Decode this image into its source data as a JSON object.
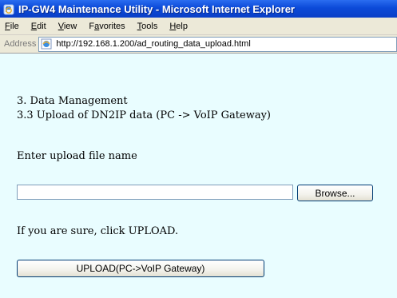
{
  "window": {
    "title": "IP-GW4 Maintenance Utility - Microsoft Internet Explorer",
    "icon": "ie-icon"
  },
  "menu": {
    "items": [
      {
        "label": "File",
        "key": "F"
      },
      {
        "label": "Edit",
        "key": "E"
      },
      {
        "label": "View",
        "key": "V"
      },
      {
        "label": "Favorites",
        "key": "a"
      },
      {
        "label": "Tools",
        "key": "T"
      },
      {
        "label": "Help",
        "key": "H"
      }
    ]
  },
  "address_bar": {
    "label": "Address",
    "url": "http://192.168.1.200/ad_routing_data_upload.html",
    "icon": "ie-page-icon"
  },
  "content": {
    "section_title": "3. Data Management",
    "subsection_title": "3.3 Upload of DN2IP data (PC -> VoIP Gateway)",
    "file_prompt": "Enter upload file name",
    "file_input_value": "",
    "browse_label": "Browse...",
    "confirm_text": "If you are sure, click UPLOAD.",
    "upload_label": "UPLOAD(PC->VoIP Gateway)",
    "background_color": "#e9fdff"
  }
}
